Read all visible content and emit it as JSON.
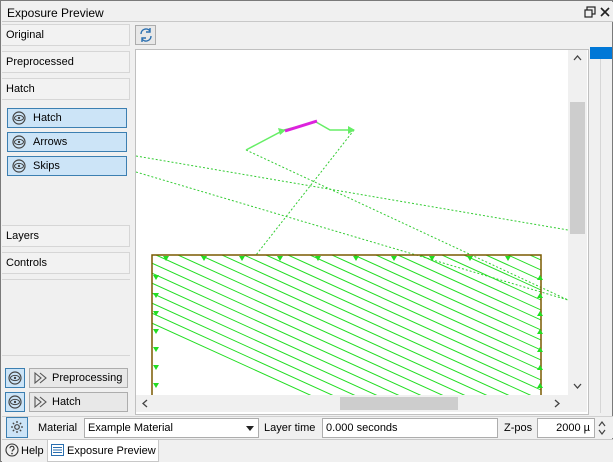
{
  "window": {
    "title": "Exposure Preview"
  },
  "left_panel": {
    "sections": [
      {
        "label": "Original"
      },
      {
        "label": "Preprocessed"
      },
      {
        "label": "Hatch"
      }
    ],
    "hatch_toggles": [
      {
        "label": "Hatch",
        "icon": "eye-icon"
      },
      {
        "label": "Arrows",
        "icon": "eye-icon"
      },
      {
        "label": "Skips",
        "icon": "eye-icon"
      }
    ],
    "lower_sections": [
      {
        "label": "Layers"
      },
      {
        "label": "Controls"
      }
    ],
    "bottom_toggles": [
      {
        "label": "Preprocessing",
        "icon": "eye-icon",
        "sub_icon": "arrow-icon"
      },
      {
        "label": "Hatch",
        "icon": "eye-icon",
        "sub_icon": "arrow-icon"
      }
    ]
  },
  "toolbar": {
    "refresh_icon": "refresh-icon"
  },
  "bottom_bar": {
    "material_label": "Material",
    "material_value": "Example Material",
    "layer_time_label": "Layer time",
    "layer_time_value": "0.000 seconds",
    "zpos_label": "Z-pos",
    "zpos_value": "2000 µ"
  },
  "tabs": [
    {
      "label": "Help",
      "icon": "help-icon",
      "active": false
    },
    {
      "label": "Exposure Preview",
      "icon": "list-icon",
      "active": true
    }
  ],
  "colors": {
    "hatch_green": "#22dd22",
    "contour_brown": "#7a5a00",
    "jump_green": "#33cc33",
    "skip_magenta": "#dd22dd",
    "accent_blue": "#0078d7"
  }
}
